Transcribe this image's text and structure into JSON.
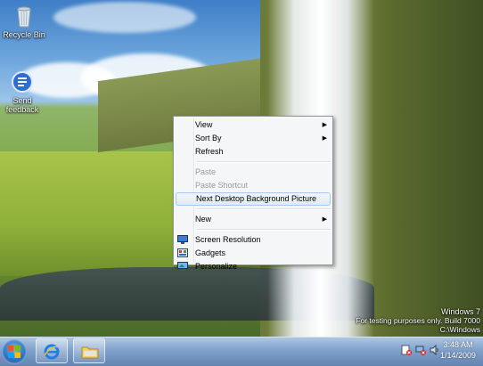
{
  "desktop": {
    "icons": [
      {
        "name": "recycle-bin",
        "label": "Recycle Bin"
      },
      {
        "name": "send-feedback",
        "label": "Send feedback"
      }
    ],
    "watermark": {
      "line1": "Windows 7",
      "line2": "For testing purposes only. Build 7000",
      "line3": "C:\\Windows"
    }
  },
  "context_menu": {
    "items": [
      {
        "label": "View",
        "submenu": true,
        "enabled": true
      },
      {
        "label": "Sort By",
        "submenu": true,
        "enabled": true
      },
      {
        "label": "Refresh",
        "submenu": false,
        "enabled": true
      },
      {
        "label": "Paste",
        "submenu": false,
        "enabled": false
      },
      {
        "label": "Paste Shortcut",
        "submenu": false,
        "enabled": false
      },
      {
        "label": "Next Desktop Background Picture",
        "submenu": false,
        "enabled": true,
        "highlighted": true
      },
      {
        "label": "New",
        "submenu": true,
        "enabled": true
      },
      {
        "label": "Screen Resolution",
        "icon": "monitor-icon",
        "enabled": true
      },
      {
        "label": "Gadgets",
        "icon": "gadgets-icon",
        "enabled": true
      },
      {
        "label": "Personalize",
        "icon": "personalize-icon",
        "enabled": true
      }
    ]
  },
  "taskbar": {
    "pinned": [
      "internet-explorer-icon",
      "windows-explorer-icon"
    ],
    "tray_icons": [
      "action-center-icon",
      "network-icon",
      "volume-icon"
    ],
    "clock": {
      "time": "3:48 AM",
      "date": "1/14/2009"
    }
  },
  "colors": {
    "menu_bg": "#f5f6f7",
    "highlight_border": "#a8c8ef",
    "taskbar": "#7a9bc8"
  }
}
